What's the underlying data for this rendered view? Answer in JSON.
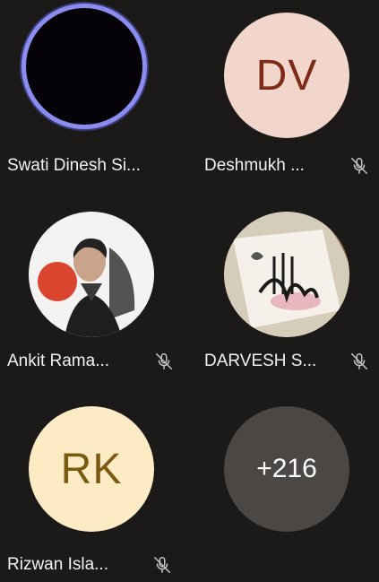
{
  "participants": [
    {
      "name": "Swati Dinesh Si...",
      "avatar": "speaking-dark",
      "muted": false
    },
    {
      "name": "Deshmukh ...",
      "initials": "DV",
      "avatar_bg": "#f3d6cb",
      "avatar_fg": "#7a2c16",
      "muted": true
    },
    {
      "name": "Ankit Rama...",
      "avatar": "photo-portrait",
      "muted": true
    },
    {
      "name": "DARVESH S...",
      "avatar": "photo-calligraphy",
      "muted": true
    },
    {
      "name": "Rizwan Isla...",
      "initials": "RK",
      "avatar_bg": "#fcebc4",
      "avatar_fg": "#7a5a10",
      "muted": true
    }
  ],
  "overflow": {
    "label": "+216",
    "bg": "#4a4745"
  },
  "colors": {
    "speaking_ring": "#8b8cf0",
    "background": "#1b1a19",
    "text": "#f3f2f1",
    "mic_muted": "#c8c6c4"
  },
  "icons": {
    "mic_muted": "mic-off-icon"
  }
}
